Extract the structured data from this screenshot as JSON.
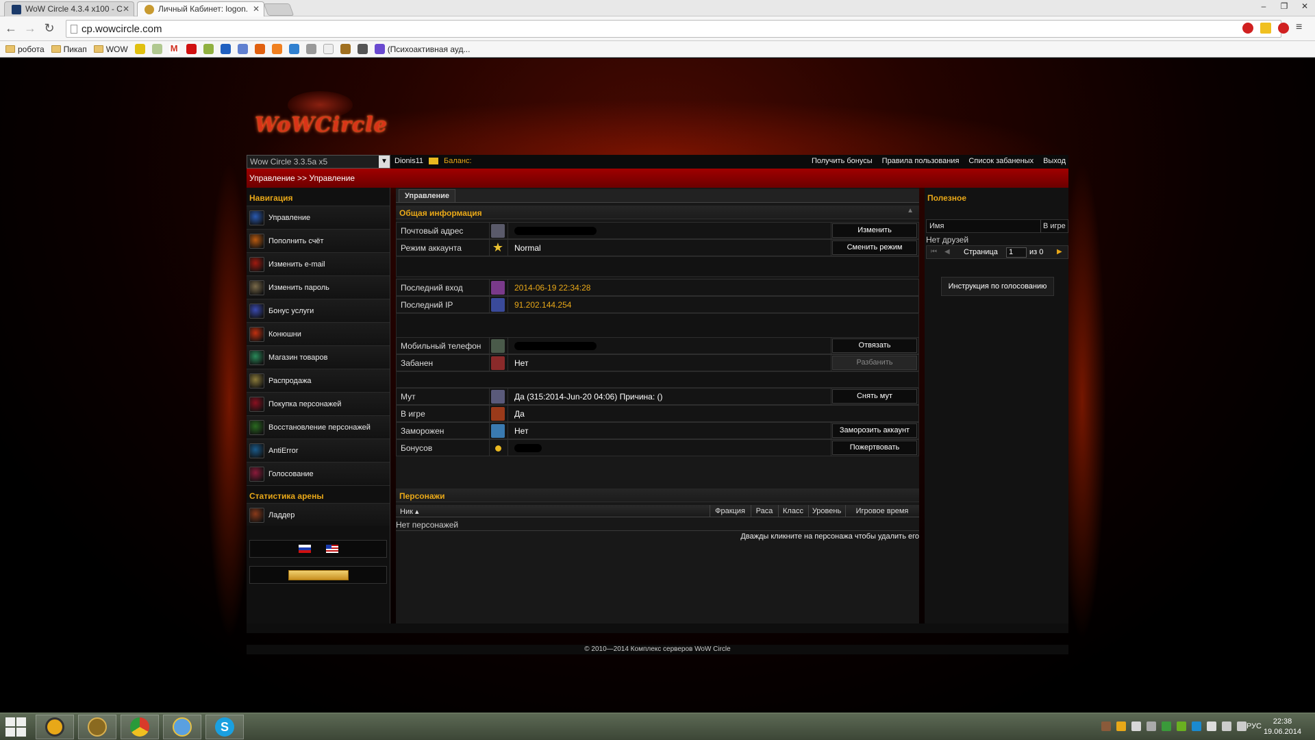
{
  "browser": {
    "tabs": [
      {
        "title": "WoW Circle 4.3.4 x100 - C",
        "active": false
      },
      {
        "title": "Личный Кабинет: logon.",
        "active": true
      }
    ],
    "url": "cp.wowcircle.com",
    "bookmarks": [
      {
        "label": "робота",
        "type": "folder"
      },
      {
        "label": "Пикап",
        "type": "folder"
      },
      {
        "label": "WOW",
        "type": "folder"
      },
      {
        "label": "(Психоактивная ауд...",
        "type": "link"
      }
    ]
  },
  "site": {
    "logo_text": "WoWCircle",
    "realm_select": "Wow Circle 3.3.5a x5",
    "username": "Dionis11",
    "balance_label": "Баланс:",
    "top_links": [
      "Получить бонусы",
      "Правила пользования",
      "Список забаненых",
      "Выход"
    ],
    "breadcrumb": "Управление >> Управление"
  },
  "sidebar": {
    "nav_heading": "Навигация",
    "items": [
      {
        "label": "Управление",
        "icon": "management-icon",
        "color": "#2a5ab0"
      },
      {
        "label": "Пополнить счёт",
        "icon": "wallet-icon",
        "color": "#b85a10"
      },
      {
        "label": "Изменить e-mail",
        "icon": "email-icon",
        "color": "#a01a10"
      },
      {
        "label": "Изменить пароль",
        "icon": "password-icon",
        "color": "#7a6a4a"
      },
      {
        "label": "Бонус услуги",
        "icon": "bonus-icon",
        "color": "#3a4ab0"
      },
      {
        "label": "Конюшни",
        "icon": "stable-icon",
        "color": "#c03010"
      },
      {
        "label": "Магазин товаров",
        "icon": "shop-icon",
        "color": "#2a8a5a"
      },
      {
        "label": "Распродажа",
        "icon": "sale-icon",
        "color": "#8a7a3a"
      },
      {
        "label": "Покупка персонажей",
        "icon": "buy-character-icon",
        "color": "#8a1020"
      },
      {
        "label": "Восстановление персонажей",
        "icon": "restore-character-icon",
        "color": "#2a6a20"
      },
      {
        "label": "AntiError",
        "icon": "antierror-icon",
        "color": "#1a5a8a"
      },
      {
        "label": "Голосование",
        "icon": "vote-icon",
        "color": "#8a1a3a"
      }
    ],
    "arena_heading": "Статистика арены",
    "arena_items": [
      {
        "label": "Ладдер",
        "icon": "ladder-icon",
        "color": "#8a3a1a"
      }
    ]
  },
  "main": {
    "tab_label": "Управление",
    "general_heading": "Общая информация",
    "rows": {
      "email": {
        "label": "Почтовый адрес",
        "button": "Изменить"
      },
      "mode": {
        "label": "Режим аккаунта",
        "value": "Normal",
        "button": "Сменить режим"
      },
      "last_login": {
        "label": "Последний вход",
        "value": "2014-06-19 22:34:28"
      },
      "last_ip": {
        "label": "Последний IP",
        "value": "91.202.144.254"
      },
      "phone": {
        "label": "Мобильный телефон",
        "button": "Отвязать"
      },
      "banned": {
        "label": "Забанен",
        "value": "Нет",
        "button": "Разбанить"
      },
      "mute": {
        "label": "Мут",
        "value": "Да (315:2014-Jun-20 04:06) Причина: ()",
        "button": "Снять мут"
      },
      "ingame": {
        "label": "В игре",
        "value": "Да"
      },
      "frozen": {
        "label": "Заморожен",
        "value": "Нет",
        "button": "Заморозить аккаунт"
      },
      "bonuses": {
        "label": "Бонусов",
        "button": "Пожертвовать"
      }
    },
    "characters": {
      "heading": "Персонажи",
      "columns": [
        "Ник ▴",
        "Фракция",
        "Раса",
        "Класс",
        "Уровень",
        "Игровое время"
      ],
      "empty": "Нет персонажей",
      "hint": "Дважды кликните на персонажа чтобы удалить его"
    }
  },
  "right": {
    "heading": "Полезное",
    "friends_columns": [
      "Имя",
      "В игре"
    ],
    "no_friends": "Нет друзей",
    "page_label": "Страница",
    "page_value": "1",
    "of_label": "из 0",
    "vote_button": "Инструкция по голосованию"
  },
  "footer": {
    "copyright": "© 2010—2014 Комплекс серверов WoW Circle"
  },
  "taskbar": {
    "language": "РУС",
    "time": "22:38",
    "date": "19.06.2014"
  }
}
